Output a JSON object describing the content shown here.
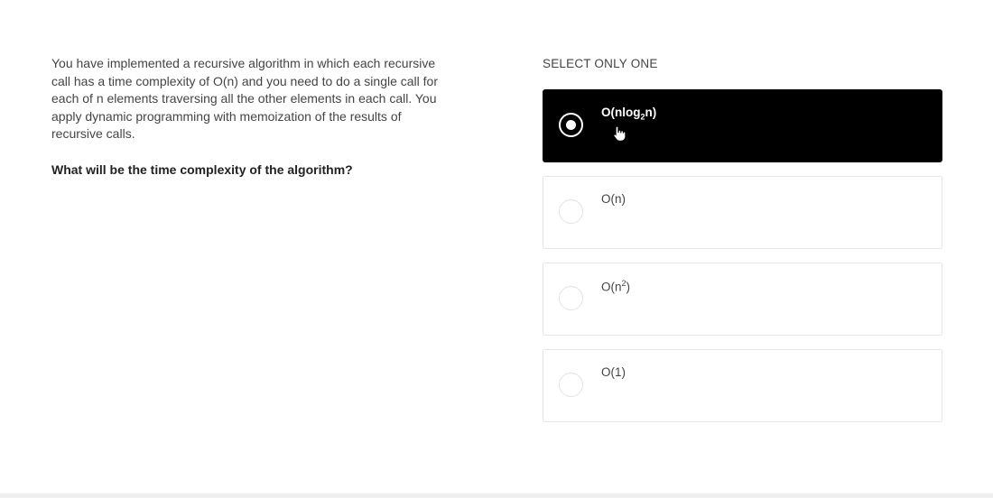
{
  "question": {
    "text": "You have implemented a recursive algorithm in which each recursive call has a time complexity of O(n) and you need to do a single call for each of n elements traversing all the other elements in each call. You apply dynamic programming with memoization of the results of recursive calls.",
    "prompt": "What will be the time complexity of the algorithm?"
  },
  "options": {
    "instruction": "SELECT ONLY ONE",
    "items": [
      {
        "pre": "O(nlog",
        "script": "2",
        "post": "n)",
        "selected": true
      },
      {
        "pre": "O(n)",
        "script": "",
        "post": "",
        "selected": false
      },
      {
        "pre": "O(n",
        "script": "2",
        "post": ")",
        "selected": false
      },
      {
        "pre": "O(1)",
        "script": "",
        "post": "",
        "selected": false
      }
    ]
  },
  "icons": {
    "cursor": "hand-pointer-icon"
  }
}
